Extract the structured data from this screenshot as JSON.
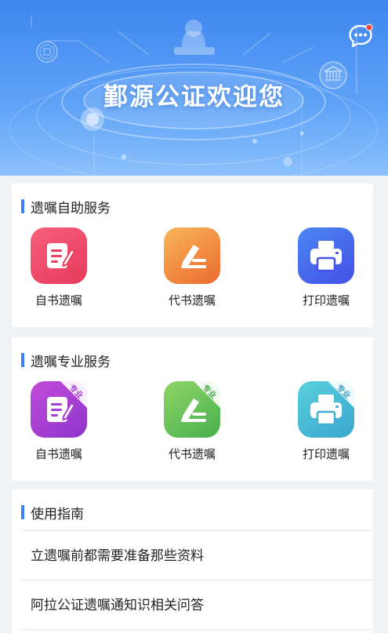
{
  "banner": {
    "title": "鄞源公证欢迎您",
    "message_icon": "chat-bubble-icon",
    "colors": {
      "top": "#3f86ee",
      "bottom": "#8cc1fb"
    }
  },
  "self_service": {
    "title": "遗嘱自助服务",
    "items": [
      {
        "label": "自书遗嘱",
        "icon": "document-edit-icon",
        "color": "#e9415f"
      },
      {
        "label": "代书遗嘱",
        "icon": "pen-sign-icon",
        "color": "#ee7a36"
      },
      {
        "label": "打印遗嘱",
        "icon": "printer-icon",
        "color": "#4553e6"
      }
    ]
  },
  "pro_service": {
    "title": "遗嘱专业服务",
    "badge": "专业",
    "items": [
      {
        "label": "自书遗嘱",
        "icon": "document-edit-icon",
        "color": "#a63fd2"
      },
      {
        "label": "代书遗嘱",
        "icon": "pen-sign-icon",
        "color": "#5ab853"
      },
      {
        "label": "打印遗嘱",
        "icon": "printer-icon",
        "color": "#44afd3"
      }
    ]
  },
  "guide": {
    "title": "使用指南",
    "items": [
      "立遗嘱前都需要准备那些资料",
      "阿拉公证遗嘱通知识相关问答"
    ]
  },
  "accent_color": "#3b7ff0"
}
